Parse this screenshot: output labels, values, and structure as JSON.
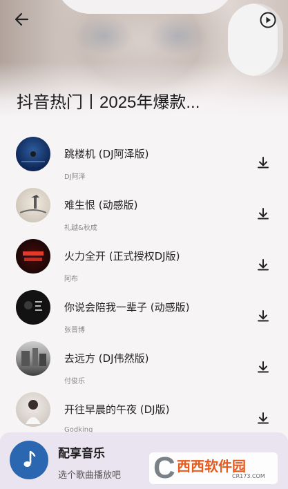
{
  "header": {
    "back_icon": "arrow-left-icon",
    "play_icon": "play-circle-icon",
    "title": "抖音热门丨2025年爆款..."
  },
  "songs": [
    {
      "title": "跳楼机 (DJ阿泽版)",
      "artist": "DJ阿泽",
      "cover_color": "#0e2756"
    },
    {
      "title": "难生恨 (动感版)",
      "artist": "礼越&秋成",
      "cover_color": "#d9d2c6"
    },
    {
      "title": "火力全开 (正式授权DJ版)",
      "artist": "阿布",
      "cover_color": "#1a0707"
    },
    {
      "title": "你说会陪我一辈子 (动感版)",
      "artist": "张晋博",
      "cover_color": "#111111"
    },
    {
      "title": "去远方 (DJ伟然版)",
      "artist": "付俊乐",
      "cover_color": "#9a9a9a"
    },
    {
      "title": "开往早晨的午夜 (DJ版)",
      "artist": "Godking",
      "cover_color": "#d8d2ce"
    }
  ],
  "download_icon": "download-icon",
  "player": {
    "title": "配享音乐",
    "subtitle": "选个歌曲播放吧",
    "icon": "music-note-icon",
    "accent": "#2b67b1"
  },
  "watermark": {
    "main": "西西软件园",
    "sub": "CR173.COM"
  }
}
